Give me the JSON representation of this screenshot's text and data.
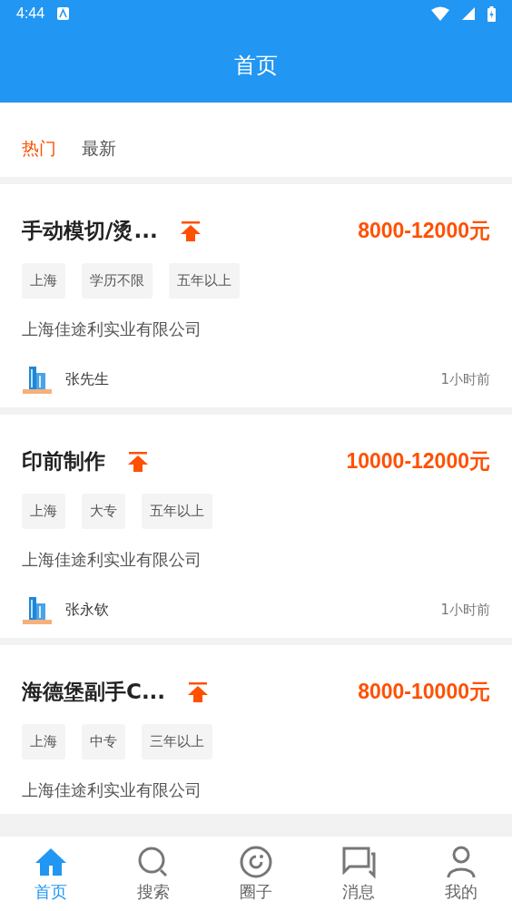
{
  "status_bar": {
    "time": "4:44"
  },
  "header": {
    "title": "首页"
  },
  "tabs": [
    {
      "label": "热门",
      "selected": true
    },
    {
      "label": "最新",
      "selected": false
    }
  ],
  "jobs": [
    {
      "title": "手动模切/烫...",
      "pinned": true,
      "salary": "8000-12000元",
      "tags": [
        "上海",
        "学历不限",
        "五年以上"
      ],
      "company": "上海佳途利实业有限公司",
      "contact": "张先生",
      "time": "1小时前"
    },
    {
      "title": "印前制作",
      "pinned": true,
      "salary": "10000-12000元",
      "tags": [
        "上海",
        "大专",
        "五年以上"
      ],
      "company": "上海佳途利实业有限公司",
      "contact": "张永钦",
      "time": "1小时前"
    },
    {
      "title": "海德堡副手C...",
      "pinned": true,
      "salary": "8000-10000元",
      "tags": [
        "上海",
        "中专",
        "三年以上"
      ],
      "company": "上海佳途利实业有限公司"
    }
  ],
  "nav": [
    {
      "label": "首页",
      "kind": "home",
      "selected": true
    },
    {
      "label": "搜索",
      "kind": "search",
      "selected": false
    },
    {
      "label": "圈子",
      "kind": "circle",
      "selected": false
    },
    {
      "label": "消息",
      "kind": "chat",
      "selected": false
    },
    {
      "label": "我的",
      "kind": "person",
      "selected": false
    }
  ]
}
